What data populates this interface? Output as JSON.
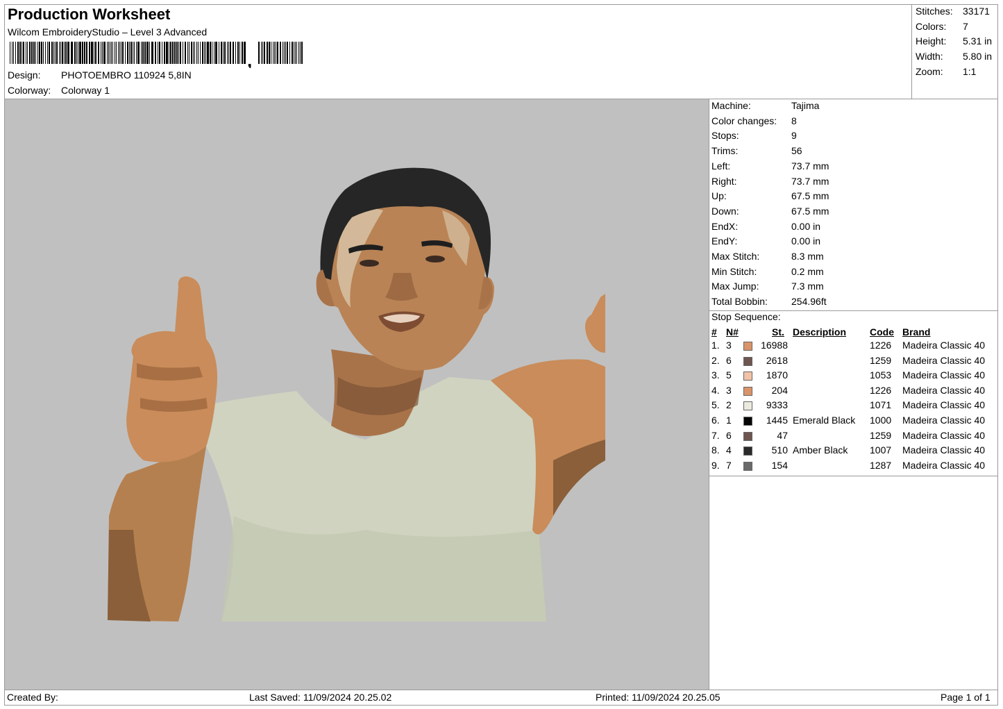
{
  "header": {
    "title": "Production Worksheet",
    "subtitle": "Wilcom EmbroideryStudio – Level 3 Advanced",
    "design_label": "Design:",
    "design_value": "PHOTOEMBRO 110924 5,8IN",
    "colorway_label": "Colorway:",
    "colorway_value": "Colorway 1"
  },
  "stats": [
    {
      "label": "Stitches:",
      "value": "33171"
    },
    {
      "label": "Colors:",
      "value": "7"
    },
    {
      "label": "Height:",
      "value": "5.31 in"
    },
    {
      "label": "Width:",
      "value": "5.80 in"
    },
    {
      "label": "Zoom:",
      "value": "1:1"
    }
  ],
  "machine": [
    {
      "label": "Machine:",
      "value": "Tajima"
    },
    {
      "label": "Color changes:",
      "value": "8"
    },
    {
      "label": "Stops:",
      "value": "9"
    },
    {
      "label": "Trims:",
      "value": "56"
    },
    {
      "label": "Left:",
      "value": "73.7 mm"
    },
    {
      "label": "Right:",
      "value": "73.7 mm"
    },
    {
      "label": "Up:",
      "value": "67.5 mm"
    },
    {
      "label": "Down:",
      "value": "67.5 mm"
    },
    {
      "label": "EndX:",
      "value": "0.00 in"
    },
    {
      "label": "EndY:",
      "value": "0.00 in"
    },
    {
      "label": "Max Stitch:",
      "value": "8.3 mm"
    },
    {
      "label": "Min Stitch:",
      "value": "0.2 mm"
    },
    {
      "label": "Max Jump:",
      "value": "7.3 mm"
    },
    {
      "label": "Total Bobbin:",
      "value": "254.96ft"
    }
  ],
  "stop_sequence": {
    "title": "Stop Sequence:",
    "headers": {
      "num": "#",
      "n": "N#",
      "st": "St.",
      "desc": "Description",
      "code": "Code",
      "brand": "Brand"
    },
    "rows": [
      {
        "num": "1.",
        "n": "3",
        "color": "#d9946a",
        "st": "16988",
        "desc": "",
        "code": "1226",
        "brand": "Madeira Classic 40"
      },
      {
        "num": "2.",
        "n": "6",
        "color": "#6e5550",
        "st": "2618",
        "desc": "",
        "code": "1259",
        "brand": "Madeira Classic 40"
      },
      {
        "num": "3.",
        "n": "5",
        "color": "#f2c2a8",
        "st": "1870",
        "desc": "",
        "code": "1053",
        "brand": "Madeira Classic 40"
      },
      {
        "num": "4.",
        "n": "3",
        "color": "#d9946a",
        "st": "204",
        "desc": "",
        "code": "1226",
        "brand": "Madeira Classic 40"
      },
      {
        "num": "5.",
        "n": "2",
        "color": "#ece9de",
        "st": "9333",
        "desc": "",
        "code": "1071",
        "brand": "Madeira Classic 40"
      },
      {
        "num": "6.",
        "n": "1",
        "color": "#050505",
        "st": "1445",
        "desc": "Emerald Black",
        "code": "1000",
        "brand": "Madeira Classic 40"
      },
      {
        "num": "7.",
        "n": "6",
        "color": "#6e5550",
        "st": "47",
        "desc": "",
        "code": "1259",
        "brand": "Madeira Classic 40"
      },
      {
        "num": "8.",
        "n": "4",
        "color": "#2a2a2a",
        "st": "510",
        "desc": "Amber Black",
        "code": "1007",
        "brand": "Madeira Classic 40"
      },
      {
        "num": "9.",
        "n": "7",
        "color": "#6a6a6a",
        "st": "154",
        "desc": "",
        "code": "1287",
        "brand": "Madeira Classic 40"
      }
    ]
  },
  "footer": {
    "created_by": "Created By:",
    "last_saved": "Last Saved: 11/09/2024 20.25.02",
    "printed": "Printed: 11/09/2024 20.25.05",
    "page": "Page 1 of 1"
  },
  "colors": {
    "canvas_bg": "#c0c0c0",
    "skin": "#c98c5a",
    "skin_dark": "#8a5a38",
    "tank_top": "#d9dccb",
    "hair": "#1e1e1e"
  }
}
